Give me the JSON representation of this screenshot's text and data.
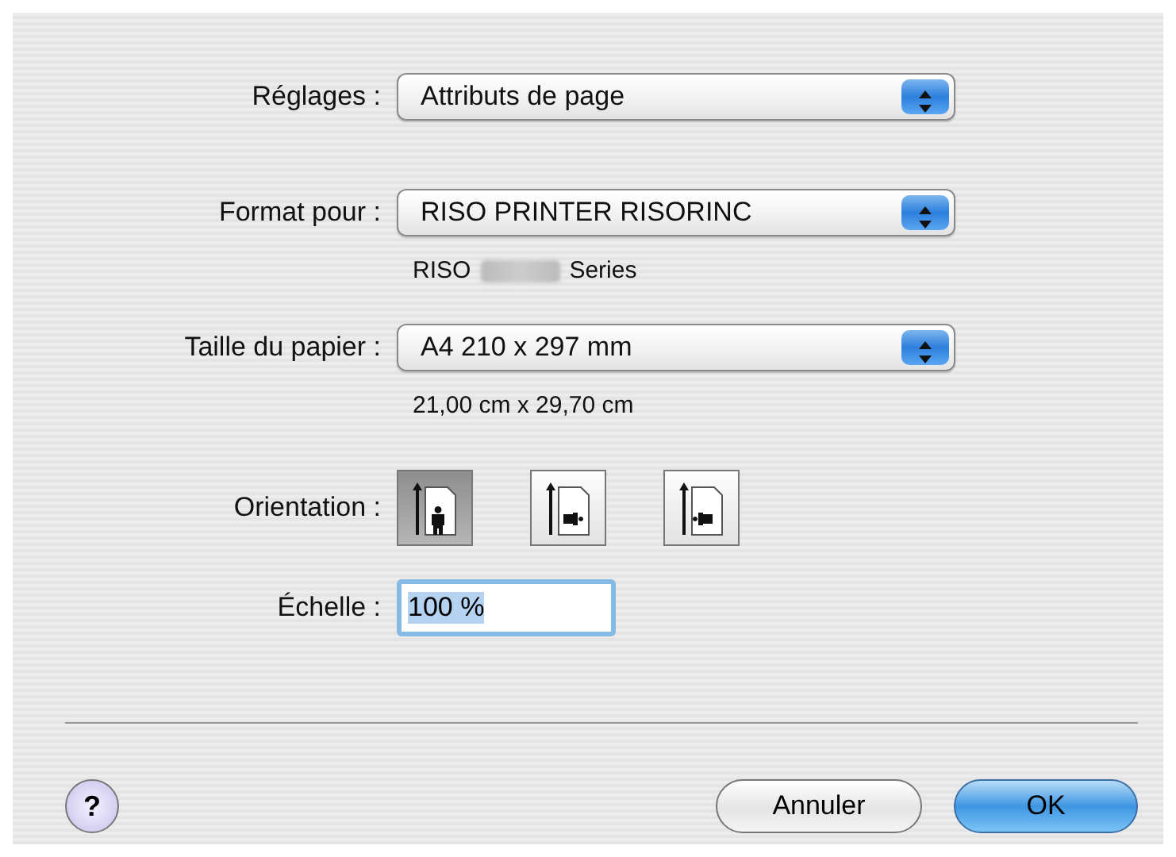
{
  "rows": [
    {
      "kind": "popup",
      "label": "Réglages :",
      "value": "Attributs de page"
    },
    {
      "kind": "popup",
      "label": "Format pour :",
      "value": "RISO PRINTER RISORINC",
      "note": {
        "before": "RISO",
        "after": "Series",
        "redacted": true
      }
    },
    {
      "kind": "popup",
      "label": "Taille du papier :",
      "value": "A4 210 x 297 mm",
      "note": {
        "before": "21,00 cm x 29,70 cm",
        "redacted": false
      }
    },
    {
      "kind": "orientation",
      "label": "Orientation :",
      "options": [
        {
          "kind": "portrait",
          "selected": true
        },
        {
          "kind": "landscape",
          "selected": false
        },
        {
          "kind": "reverse",
          "selected": false
        }
      ]
    },
    {
      "kind": "field",
      "label": "Échelle :",
      "value": "100 %",
      "focused": true
    }
  ],
  "help": "?",
  "buttons": [
    {
      "label": "Annuler",
      "default": false
    },
    {
      "label": "OK",
      "default": true
    }
  ]
}
